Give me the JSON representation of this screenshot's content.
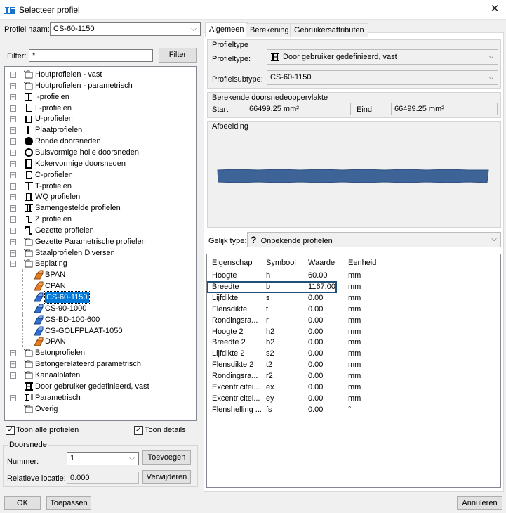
{
  "window": {
    "title": "Selecteer profiel",
    "close_symbol": "✕"
  },
  "left": {
    "profile_name_label": "Profiel naam:",
    "profile_name_value": "CS-60-1150",
    "filter_label": "Filter:",
    "filter_value": "*",
    "filter_button": "Filter",
    "tree": [
      {
        "label": "Houtprofielen - vast",
        "icon": "folder-icon",
        "level": 0,
        "expander": "+"
      },
      {
        "label": "Houtprofielen - parametrisch",
        "icon": "folder-icon",
        "level": 0,
        "expander": "+"
      },
      {
        "label": "I-profielen",
        "icon": "i-beam-icon",
        "level": 0,
        "expander": "+"
      },
      {
        "label": "L-profielen",
        "icon": "l-profile-icon",
        "level": 0,
        "expander": "+"
      },
      {
        "label": "U-profielen",
        "icon": "u-profile-icon",
        "level": 0,
        "expander": "+"
      },
      {
        "label": "Plaatprofielen",
        "icon": "plate-icon",
        "level": 0,
        "expander": "+"
      },
      {
        "label": "Ronde doorsneden",
        "icon": "round-solid-icon",
        "level": 0,
        "expander": "+"
      },
      {
        "label": "Buisvormige holle doorsneden",
        "icon": "tube-icon",
        "level": 0,
        "expander": "+"
      },
      {
        "label": "Kokervormige doorsneden",
        "icon": "box-section-icon",
        "level": 0,
        "expander": "+"
      },
      {
        "label": "C-profielen",
        "icon": "c-profile-icon",
        "level": 0,
        "expander": "+"
      },
      {
        "label": "T-profielen",
        "icon": "t-profile-icon",
        "level": 0,
        "expander": "+"
      },
      {
        "label": "WQ profielen",
        "icon": "wq-profile-icon",
        "level": 0,
        "expander": "+"
      },
      {
        "label": "Samengestelde profielen",
        "icon": "composite-profile-icon",
        "level": 0,
        "expander": "+"
      },
      {
        "label": "Z profielen",
        "icon": "z-profile-icon",
        "level": 0,
        "expander": "+"
      },
      {
        "label": "Gezette profielen",
        "icon": "bent-profile-icon",
        "level": 0,
        "expander": "+"
      },
      {
        "label": "Gezette Parametrische profielen",
        "icon": "folder-icon",
        "level": 0,
        "expander": "+"
      },
      {
        "label": "Staalprofielen Diversen",
        "icon": "folder-icon",
        "level": 0,
        "expander": "+"
      },
      {
        "label": "Beplating",
        "icon": "folder-icon",
        "level": 0,
        "expander": "−"
      },
      {
        "label": "BPAN",
        "icon": "orange-plate-icon",
        "level": 1,
        "expander": ""
      },
      {
        "label": "CPAN",
        "icon": "orange-plate-icon",
        "level": 1,
        "expander": ""
      },
      {
        "label": "CS-60-1150",
        "icon": "blue-plate-icon",
        "level": 1,
        "expander": "",
        "selected": true
      },
      {
        "label": "CS-90-1000",
        "icon": "blue-plate-icon",
        "level": 1,
        "expander": ""
      },
      {
        "label": "CS-BD-100-600",
        "icon": "blue-plate-icon",
        "level": 1,
        "expander": ""
      },
      {
        "label": "CS-GOLFPLAAT-1050",
        "icon": "blue-plate-icon",
        "level": 1,
        "expander": ""
      },
      {
        "label": "DPAN",
        "icon": "orange-plate-icon",
        "level": 1,
        "expander": ""
      },
      {
        "label": "Betonprofielen",
        "icon": "folder-icon",
        "level": 0,
        "expander": "+"
      },
      {
        "label": "Betongerelateerd parametrisch",
        "icon": "folder-icon",
        "level": 0,
        "expander": "+"
      },
      {
        "label": "Kanaalplaten",
        "icon": "folder-icon",
        "level": 0,
        "expander": "+"
      },
      {
        "label": "Door gebruiker gedefinieerd, vast",
        "icon": "user-defined-icon",
        "level": 0,
        "expander": ""
      },
      {
        "label": "Parametrisch",
        "icon": "parametric-icon",
        "level": 0,
        "expander": "+"
      },
      {
        "label": "Overig",
        "icon": "folder-icon",
        "level": 0,
        "expander": ""
      }
    ],
    "show_all_label": "Toon alle profielen",
    "show_all_checked": "✓",
    "show_details_label": "Toon details",
    "show_details_checked": "✓",
    "cross_section_group": "Doorsnede",
    "number_label": "Nummer:",
    "number_value": "1",
    "add_button": "Toevoegen",
    "relative_location_label": "Relatieve locatie:",
    "relative_location_value": "0.000",
    "remove_button": "Verwijderen"
  },
  "tabs": [
    "Algemeen",
    "Berekening",
    "Gebruikersattributen"
  ],
  "general": {
    "profile_type_group": "Profieltype",
    "profile_type_label": "Profieltype:",
    "profile_type_value": "Door gebruiker gedefinieerd, vast",
    "profile_subtype_label": "Profielsubtype:",
    "profile_subtype_value": "CS-60-1150",
    "area_group": "Berekende doorsnedeoppervlakte",
    "start_label": "Start",
    "start_value": "66499.25 mm²",
    "end_label": "Eind",
    "end_value": "66499.25 mm²",
    "image_group": "Afbeelding",
    "equal_type_label": "Gelijk type:",
    "equal_type_icon": "?",
    "equal_type_value": "Onbekende profielen"
  },
  "properties": {
    "headers": [
      "Eigenschap",
      "Symbool",
      "Waarde",
      "Eenheid"
    ],
    "rows": [
      [
        "Hoogte",
        "h",
        "60.00",
        "mm"
      ],
      [
        "Breedte",
        "b",
        "1167.00",
        "mm"
      ],
      [
        "Lijfdikte",
        "s",
        "0.00",
        "mm"
      ],
      [
        "Flensdikte",
        "t",
        "0.00",
        "mm"
      ],
      [
        "Rondingsra...",
        "r",
        "0.00",
        "mm"
      ],
      [
        "Hoogte 2",
        "h2",
        "0.00",
        "mm"
      ],
      [
        "Breedte 2",
        "b2",
        "0.00",
        "mm"
      ],
      [
        "Lijfdikte 2",
        "s2",
        "0.00",
        "mm"
      ],
      [
        "Flensdikte 2",
        "t2",
        "0.00",
        "mm"
      ],
      [
        "Rondingsra...",
        "r2",
        "0.00",
        "mm"
      ],
      [
        "Excentricitei...",
        "ex",
        "0.00",
        "mm"
      ],
      [
        "Excentricitei...",
        "ey",
        "0.00",
        "mm"
      ],
      [
        "Flenshelling ...",
        "fs",
        "0.00",
        "°"
      ]
    ]
  },
  "footer": {
    "ok": "OK",
    "apply": "Toepassen",
    "cancel": "Annuleren"
  },
  "colors": {
    "accent": "#0078d7",
    "profile_fill": "#3e6497",
    "highlight_border": "#1f4e79",
    "orange": "#e07b22"
  }
}
